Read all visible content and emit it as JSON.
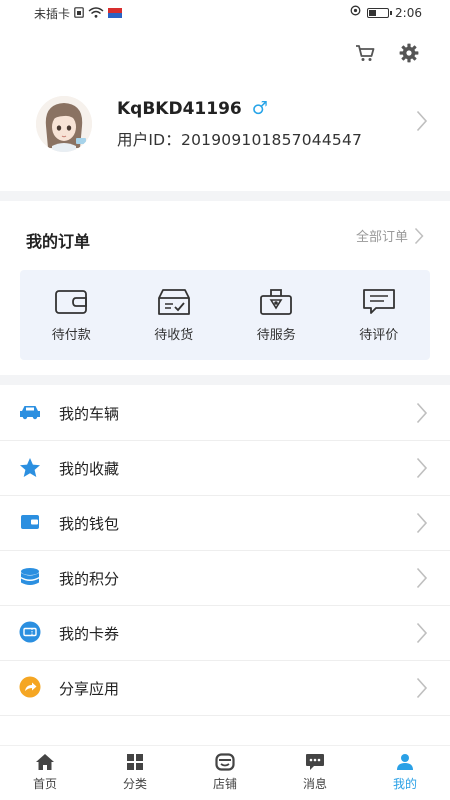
{
  "status_bar": {
    "carrier_text": "未插卡",
    "time": "2:06",
    "battery_level": 0.35
  },
  "top_actions": {
    "cart_icon": "cart-icon",
    "settings_icon": "gear-icon"
  },
  "profile": {
    "nickname": "KqBKD41196",
    "gender_symbol": "♂",
    "user_id": "用户ID：201909101857044547"
  },
  "orders": {
    "title": "我的订单",
    "all_label": "全部订单",
    "items": [
      {
        "label": "待付款",
        "icon": "wallet-icon"
      },
      {
        "label": "待收货",
        "icon": "inbox-icon"
      },
      {
        "label": "待服务",
        "icon": "gift-icon"
      },
      {
        "label": "待评价",
        "icon": "comment-icon"
      }
    ]
  },
  "menu": {
    "items": [
      {
        "label": "我的车辆",
        "icon": "car-icon"
      },
      {
        "label": "我的收藏",
        "icon": "star-icon"
      },
      {
        "label": "我的钱包",
        "icon": "wallet-icon"
      },
      {
        "label": "我的积分",
        "icon": "coins-icon"
      },
      {
        "label": "我的卡券",
        "icon": "ticket-icon"
      },
      {
        "label": "分享应用",
        "icon": "share-icon"
      }
    ]
  },
  "bottom_nav": {
    "items": [
      {
        "label": "首页",
        "icon": "home-icon"
      },
      {
        "label": "分类",
        "icon": "grid-icon"
      },
      {
        "label": "店铺",
        "icon": "store-icon"
      },
      {
        "label": "消息",
        "icon": "message-icon"
      },
      {
        "label": "我的",
        "icon": "user-icon"
      }
    ],
    "active_index": 4
  },
  "colors": {
    "accent": "#2aa0e6",
    "menu_icon_blue": "#2b8fe0",
    "share_orange": "#f5a623",
    "orders_bg": "#eff3fb"
  }
}
